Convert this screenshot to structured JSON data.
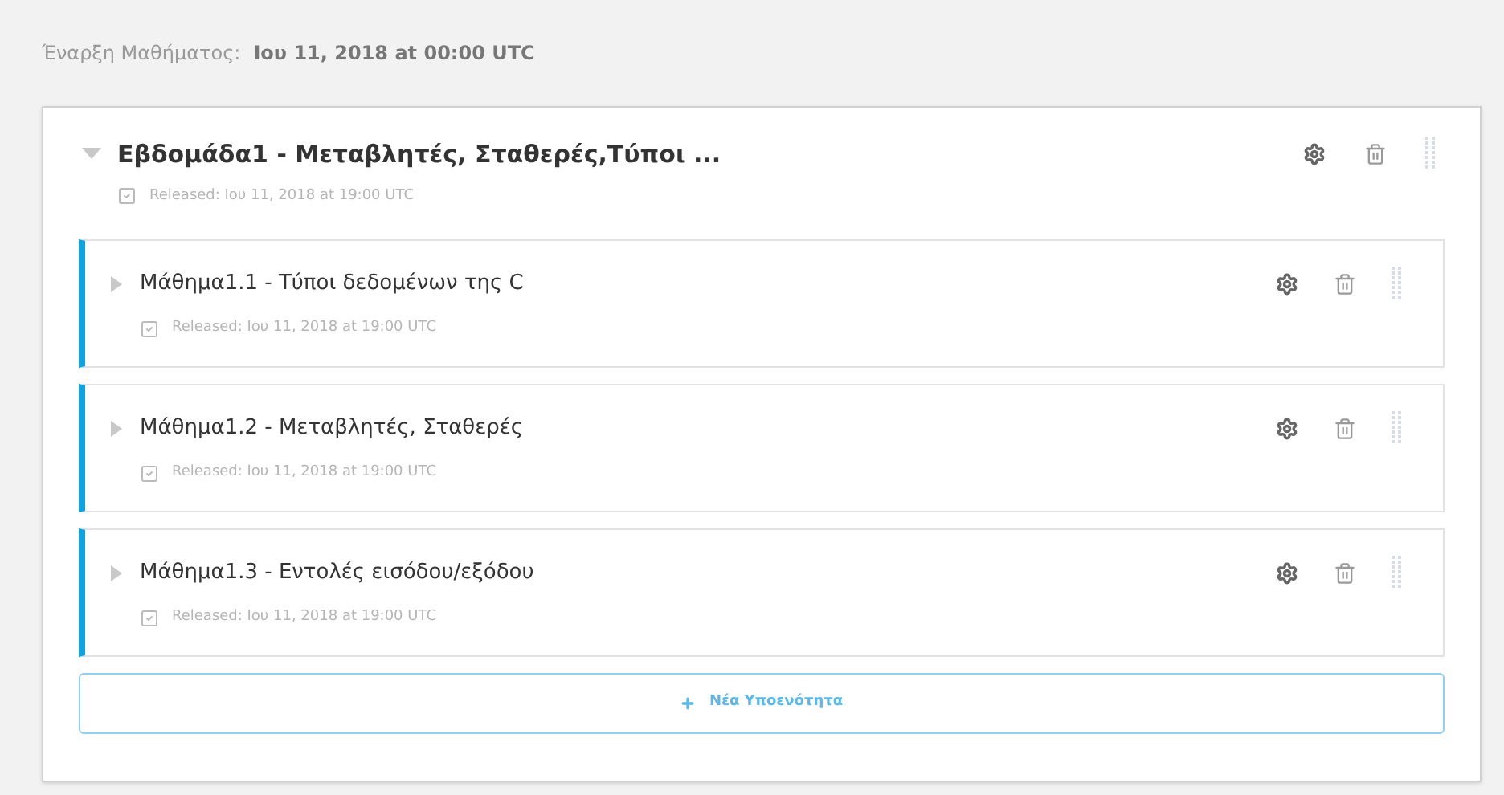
{
  "course_start": {
    "label": "Έναρξη Μαθήματος:",
    "value": "Ιου 11, 2018 at 00:00 UTC"
  },
  "section": {
    "title": "Εβδομάδα1 - Μεταβλητές, Σταθερές,Τύποι ...",
    "expanded": true,
    "released": "Released: Ιου 11, 2018 at 19:00 UTC",
    "subsections": [
      {
        "title": "Μάθημα1.1 - Τύποι δεδομένων της C",
        "expanded": false,
        "released": "Released: Ιου 11, 2018 at 19:00 UTC"
      },
      {
        "title": "Μάθημα1.2 - Μεταβλητές, Σταθερές",
        "expanded": false,
        "released": "Released: Ιου 11, 2018 at 19:00 UTC"
      },
      {
        "title": "Μάθημα1.3 - Εντολές εισόδου/εξόδου",
        "expanded": false,
        "released": "Released: Ιου 11, 2018 at 19:00 UTC"
      }
    ],
    "new_subsection_button": "Νέα Υποενότητα"
  }
}
